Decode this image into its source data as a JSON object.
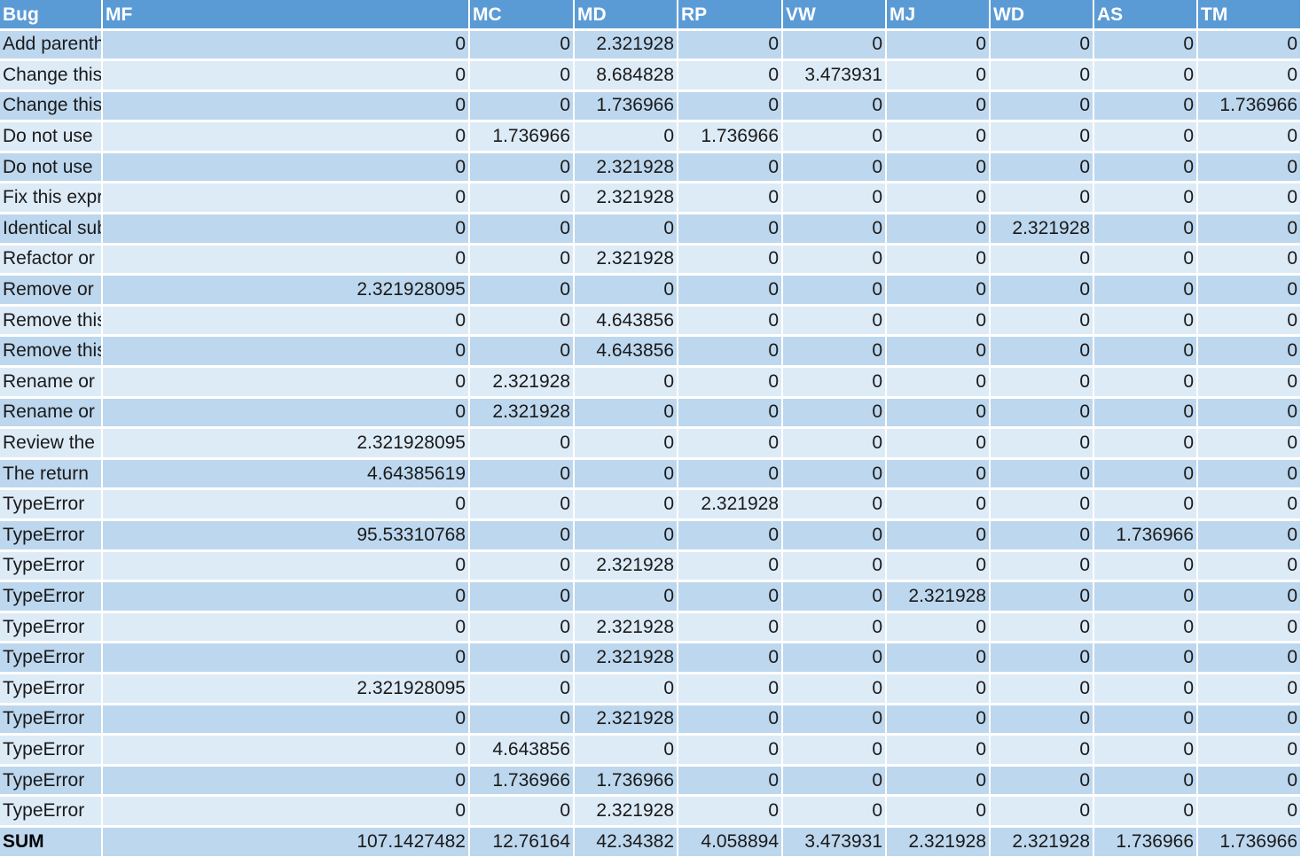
{
  "columns": [
    "Bug",
    "MF",
    "MC",
    "MD",
    "RP",
    "VW",
    "MJ",
    "WD",
    "AS",
    "TM"
  ],
  "rows": [
    {
      "bug": "Add parentheses",
      "values": [
        "0",
        "0",
        "2.321928",
        "0",
        "0",
        "0",
        "0",
        "0",
        "0"
      ]
    },
    {
      "bug": "Change this",
      "values": [
        "0",
        "0",
        "8.684828",
        "0",
        "3.473931",
        "0",
        "0",
        "0",
        "0"
      ]
    },
    {
      "bug": "Change this",
      "values": [
        "0",
        "0",
        "1.736966",
        "0",
        "0",
        "0",
        "0",
        "0",
        "1.736966"
      ]
    },
    {
      "bug": "Do not use",
      "values": [
        "0",
        "1.736966",
        "0",
        "1.736966",
        "0",
        "0",
        "0",
        "0",
        "0"
      ]
    },
    {
      "bug": "Do not use",
      "values": [
        "0",
        "0",
        "2.321928",
        "0",
        "0",
        "0",
        "0",
        "0",
        "0"
      ]
    },
    {
      "bug": "Fix this expression",
      "values": [
        "0",
        "0",
        "2.321928",
        "0",
        "0",
        "0",
        "0",
        "0",
        "0"
      ]
    },
    {
      "bug": "Identical sub-expressions",
      "values": [
        "0",
        "0",
        "0",
        "0",
        "0",
        "0",
        "2.321928",
        "0",
        "0"
      ]
    },
    {
      "bug": "Refactor or",
      "values": [
        "0",
        "0",
        "2.321928",
        "0",
        "0",
        "0",
        "0",
        "0",
        "0"
      ]
    },
    {
      "bug": "Remove or",
      "values": [
        "2.321928095",
        "0",
        "0",
        "0",
        "0",
        "0",
        "0",
        "0",
        "0"
      ]
    },
    {
      "bug": "Remove this",
      "values": [
        "0",
        "0",
        "4.643856",
        "0",
        "0",
        "0",
        "0",
        "0",
        "0"
      ]
    },
    {
      "bug": "Remove this",
      "values": [
        "0",
        "0",
        "4.643856",
        "0",
        "0",
        "0",
        "0",
        "0",
        "0"
      ]
    },
    {
      "bug": "Rename or",
      "values": [
        "0",
        "2.321928",
        "0",
        "0",
        "0",
        "0",
        "0",
        "0",
        "0"
      ]
    },
    {
      "bug": "Rename or",
      "values": [
        "0",
        "2.321928",
        "0",
        "0",
        "0",
        "0",
        "0",
        "0",
        "0"
      ]
    },
    {
      "bug": "Review the",
      "values": [
        "2.321928095",
        "0",
        "0",
        "0",
        "0",
        "0",
        "0",
        "0",
        "0"
      ]
    },
    {
      "bug": "The return",
      "values": [
        "4.64385619",
        "0",
        "0",
        "0",
        "0",
        "0",
        "0",
        "0",
        "0"
      ]
    },
    {
      "bug": "TypeError",
      "values": [
        "0",
        "0",
        "0",
        "2.321928",
        "0",
        "0",
        "0",
        "0",
        "0"
      ]
    },
    {
      "bug": "TypeError",
      "values": [
        "95.53310768",
        "0",
        "0",
        "0",
        "0",
        "0",
        "0",
        "1.736966",
        "0"
      ]
    },
    {
      "bug": "TypeError",
      "values": [
        "0",
        "0",
        "2.321928",
        "0",
        "0",
        "0",
        "0",
        "0",
        "0"
      ]
    },
    {
      "bug": "TypeError",
      "values": [
        "0",
        "0",
        "0",
        "0",
        "0",
        "2.321928",
        "0",
        "0",
        "0"
      ]
    },
    {
      "bug": "TypeError",
      "values": [
        "0",
        "0",
        "2.321928",
        "0",
        "0",
        "0",
        "0",
        "0",
        "0"
      ]
    },
    {
      "bug": "TypeError",
      "values": [
        "0",
        "0",
        "2.321928",
        "0",
        "0",
        "0",
        "0",
        "0",
        "0"
      ]
    },
    {
      "bug": "TypeError",
      "values": [
        "2.321928095",
        "0",
        "0",
        "0",
        "0",
        "0",
        "0",
        "0",
        "0"
      ]
    },
    {
      "bug": "TypeError",
      "values": [
        "0",
        "0",
        "2.321928",
        "0",
        "0",
        "0",
        "0",
        "0",
        "0"
      ]
    },
    {
      "bug": "TypeError",
      "values": [
        "0",
        "4.643856",
        "0",
        "0",
        "0",
        "0",
        "0",
        "0",
        "0"
      ]
    },
    {
      "bug": "TypeError",
      "values": [
        "0",
        "1.736966",
        "1.736966",
        "0",
        "0",
        "0",
        "0",
        "0",
        "0"
      ]
    },
    {
      "bug": "TypeError",
      "values": [
        "0",
        "0",
        "2.321928",
        "0",
        "0",
        "0",
        "0",
        "0",
        "0"
      ]
    }
  ],
  "sum": {
    "label": "SUM",
    "values": [
      "107.1427482",
      "12.76164",
      "42.34382",
      "4.058894",
      "3.473931",
      "2.321928",
      "2.321928",
      "1.736966",
      "1.736966"
    ]
  },
  "colors": {
    "header_bg": "#5b9bd5",
    "row_band_dark": "#bdd7ee",
    "row_band_light": "#ddebf7",
    "grid_line": "#ffffff"
  }
}
